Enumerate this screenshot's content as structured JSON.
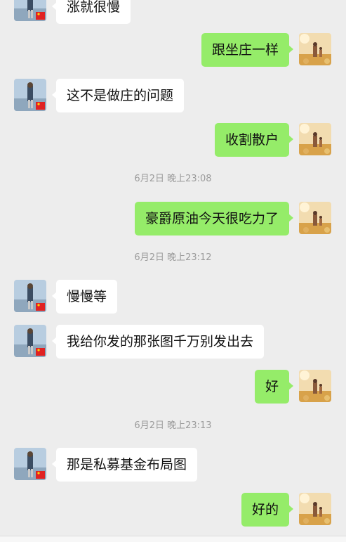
{
  "colors": {
    "background": "#ededed",
    "incoming_bubble": "#ffffff",
    "outgoing_bubble": "#95ec69",
    "timestamp": "#9b9b9b"
  },
  "messages": [
    {
      "side": "in",
      "text": "涨就很慢"
    },
    {
      "side": "out",
      "text": "跟坐庄一样"
    },
    {
      "side": "in",
      "text": "这不是做庄的问题"
    },
    {
      "side": "out",
      "text": "收割散户"
    },
    {
      "side": "out",
      "text": "豪爵原油今天很吃力了"
    },
    {
      "side": "in",
      "text": "慢慢等"
    },
    {
      "side": "in",
      "text": "我给你发的那张图千万别发出去"
    },
    {
      "side": "out",
      "text": "好"
    },
    {
      "side": "in",
      "text": "那是私募基金布局图"
    },
    {
      "side": "out",
      "text": "好的"
    }
  ],
  "timestamps": [
    "6月2日 晚上23:08",
    "6月2日 晚上23:12",
    "6月2日 晚上23:13"
  ]
}
